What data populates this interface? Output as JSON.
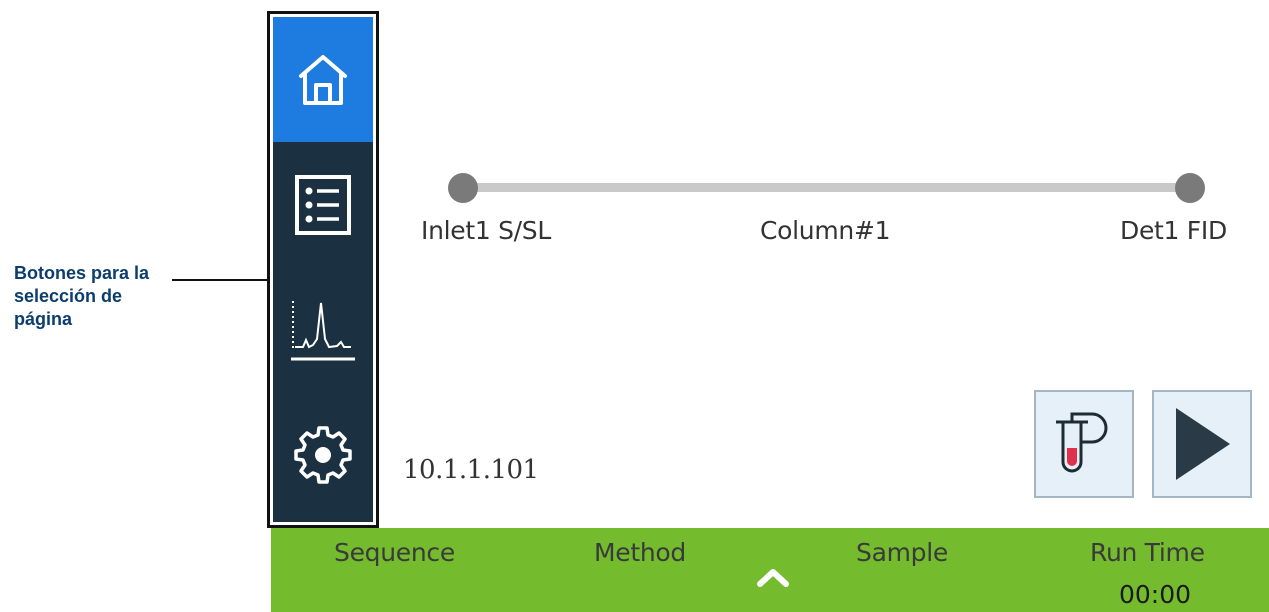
{
  "callout": {
    "text": "Botones para la selección de página"
  },
  "sidebar": {
    "items": [
      {
        "name": "home",
        "icon": "home-icon",
        "active": true
      },
      {
        "name": "list",
        "icon": "list-icon",
        "active": false
      },
      {
        "name": "chromatogram",
        "icon": "chromatogram-icon",
        "active": false
      },
      {
        "name": "settings",
        "icon": "gear-icon",
        "active": false
      }
    ]
  },
  "flow_path": {
    "inlet": "Inlet1 S/SL",
    "column": "Column#1",
    "detector": "Det1 FID"
  },
  "ip_address": "10.1.1.101",
  "actions": {
    "prep_run_icon": "vial-prep-run-icon",
    "start_icon": "play-icon"
  },
  "status_bar": {
    "sequence_label": "Sequence",
    "method_label": "Method",
    "sample_label": "Sample",
    "run_time_label": "Run Time",
    "run_time_value": "00:00",
    "expand_icon": "chevron-up-icon"
  },
  "colors": {
    "sidebar_bg": "#1b3040",
    "active_nav": "#1e7be0",
    "status_bar": "#74bb2e",
    "action_btn_bg": "#e5f0f9",
    "callout_text": "#0b3d6e"
  }
}
